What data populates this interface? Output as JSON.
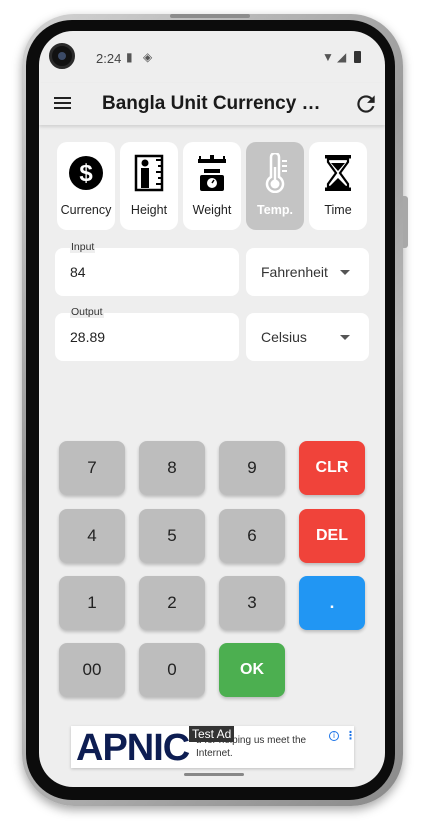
{
  "status_bar": {
    "time": "2:24"
  },
  "app_bar": {
    "title": "Bangla Unit Currency C..."
  },
  "categories": [
    {
      "label": "Currency",
      "icon": "dollar-circle-icon",
      "active": false
    },
    {
      "label": "Height",
      "icon": "height-ruler-icon",
      "active": false
    },
    {
      "label": "Weight",
      "icon": "weighing-scale-icon",
      "active": false
    },
    {
      "label": "Temp.",
      "icon": "thermometer-icon",
      "active": true
    },
    {
      "label": "Time",
      "icon": "hourglass-icon",
      "active": false
    }
  ],
  "input": {
    "label": "Input",
    "value": "84",
    "unit": "Fahrenheit"
  },
  "output": {
    "label": "Output",
    "value": "28.89",
    "unit": "Celsius"
  },
  "keypad": {
    "k7": "7",
    "k8": "8",
    "k9": "9",
    "clr": "CLR",
    "k4": "4",
    "k5": "5",
    "k6": "6",
    "del": "DEL",
    "k1": "1",
    "k2": "2",
    "k3": "3",
    "dot": ".",
    "k00": "00",
    "k0": "0",
    "ok": "OK"
  },
  "ad": {
    "logo": "APNIC",
    "badge": "Test Ad",
    "text": "u for helping us meet the Internet."
  },
  "colors": {
    "background": "#eeeeee",
    "clear_button": "#f0433a",
    "dot_button": "#2196f3",
    "ok_button": "#4caf50",
    "key_gray": "#bdbdbd"
  }
}
